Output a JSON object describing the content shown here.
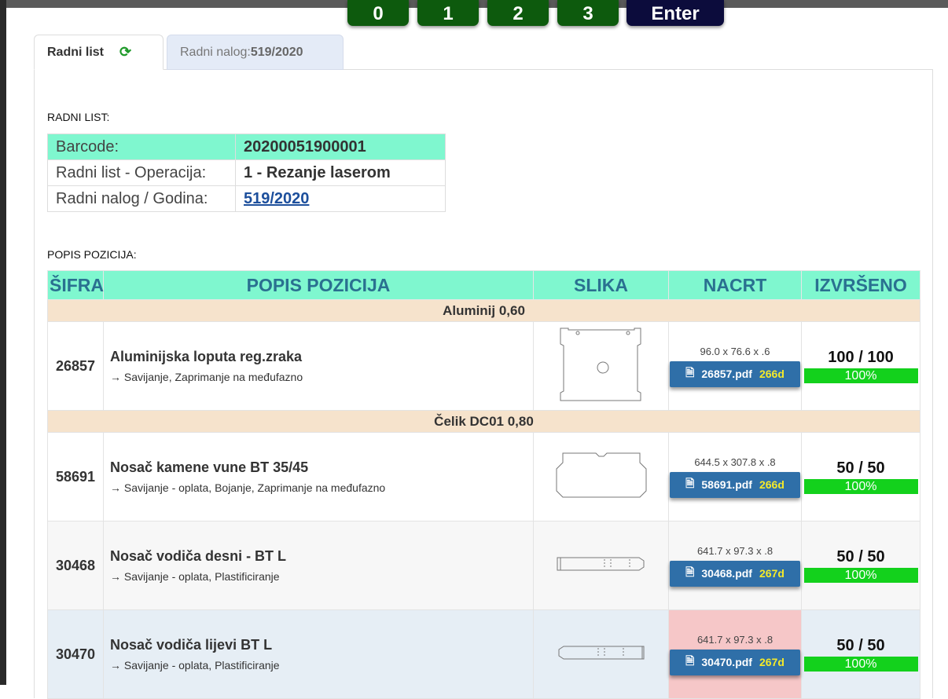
{
  "keypad": [
    "0",
    "1",
    "2",
    "3",
    "Enter"
  ],
  "tabs": {
    "radni_list": "Radni list",
    "radni_nalog_label": "Radni nalog: ",
    "radni_nalog_value": "519/2020"
  },
  "radni_list": {
    "heading": "RADNI LIST:",
    "rows": [
      {
        "key": "Barcode:",
        "value": "20200051900001"
      },
      {
        "key": "Radni list - Operacija:",
        "value": "1 - Rezanje laserom"
      },
      {
        "key": "Radni nalog / Godina:",
        "value": "519/2020"
      }
    ]
  },
  "popis": {
    "heading": "POPIS POZICIJA:",
    "columns": [
      "ŠIFRA",
      "POPIS POZICIJA",
      "SLIKA",
      "NACRT",
      "IZVRŠENO"
    ],
    "groups": [
      "Aluminij 0,60",
      "Čelik DC01 0,80"
    ],
    "items": [
      {
        "code": "26857",
        "name": "Aluminijska loputa reg.zraka",
        "ops": "→ Savijanje, Zaprimanje na međufazno",
        "dims": "96.0 x 76.6 x .6",
        "pdf": "26857.pdf",
        "age": "266d",
        "done": "100 / 100",
        "pct": "100%"
      },
      {
        "code": "58691",
        "name": "Nosač kamene vune BT 35/45",
        "ops": "→ Savijanje - oplata, Bojanje, Zaprimanje na međufazno",
        "dims": "644.5 x 307.8 x .8",
        "pdf": "58691.pdf",
        "age": "266d",
        "done": "50 / 50",
        "pct": "100%"
      },
      {
        "code": "30468",
        "name": "Nosač vodiča desni - BT L",
        "ops": "→ Savijanje - oplata, Plastificiranje",
        "dims": "641.7 x 97.3 x .8",
        "pdf": "30468.pdf",
        "age": "267d",
        "done": "50 / 50",
        "pct": "100%"
      },
      {
        "code": "30470",
        "name": "Nosač vodiča lijevi BT L",
        "ops": "→ Savijanje - oplata, Plastificiranje",
        "dims": "641.7 x 97.3 x .8",
        "pdf": "30470.pdf",
        "age": "267d",
        "done": "50 / 50",
        "pct": "100%"
      }
    ]
  },
  "colors": {
    "accent": "#7ff7cf",
    "group": "#f6e3cc",
    "pdf_button": "#2f6fa8",
    "progress": "#13d11c",
    "warning": "#f6c7c8"
  }
}
